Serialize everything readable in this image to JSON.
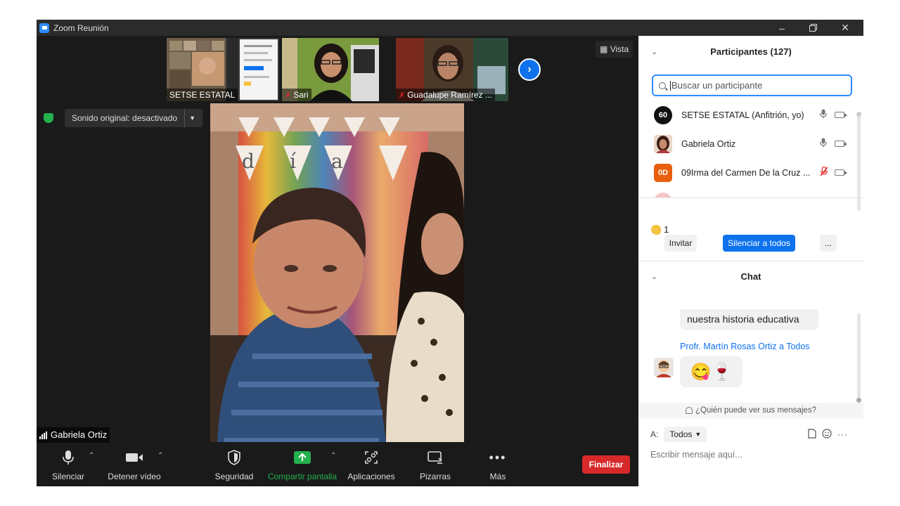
{
  "window": {
    "title": "Zoom Reunión"
  },
  "thumbnails": [
    {
      "name": "SETSE ESTATAL",
      "muted": false
    },
    {
      "name": "Sari",
      "muted": true
    },
    {
      "name": "Guadalupe Ramírez ...",
      "muted": true
    }
  ],
  "vista_label": "Vista",
  "sound_original": "Sonido original: desactivado",
  "active_speaker": "Gabriela Ortiz",
  "banner_letters": [
    "d",
    "í",
    "a"
  ],
  "toolbar": {
    "mute": "Silenciar",
    "video": "Detener vídeo",
    "security": "Seguridad",
    "share": "Compartir pantalla",
    "apps": "Aplicaciones",
    "whiteboards": "Pizarras",
    "more": "Más",
    "end": "Finalizar"
  },
  "participants_panel": {
    "title": "Participantes (127)",
    "search_placeholder": "Buscar un participante",
    "participants": [
      {
        "avatar_text": "60",
        "name": "SETSE ESTATAL (Anfitrión, yo)",
        "mic_muted": false,
        "avatar_color": "#111111"
      },
      {
        "avatar_text": "",
        "name": "Gabriela Ortiz",
        "mic_muted": false,
        "avatar_color": "#8a5a44"
      },
      {
        "avatar_text": "0D",
        "name": "09Irma del Carmen De la Cruz ...",
        "mic_muted": true,
        "avatar_color": "#e8600e"
      }
    ],
    "reaction_count": "1",
    "invite": "Invitar",
    "mute_all": "Silenciar a todos",
    "more": "..."
  },
  "chat": {
    "title": "Chat",
    "prev_message": "nuestra historia educativa",
    "sender": "Profr. Martín Rosas Ortiz a Todos",
    "emoji_message": "😋🍷",
    "who_can_see": "¿Quién puede ver sus mensajes?",
    "to_label": "A:",
    "to_value": "Todos",
    "input_placeholder": "Escribir mensaje aquí..."
  },
  "colors": {
    "accent": "#0e72ed",
    "share_green": "#23b14d",
    "end_red": "#d7282a"
  }
}
